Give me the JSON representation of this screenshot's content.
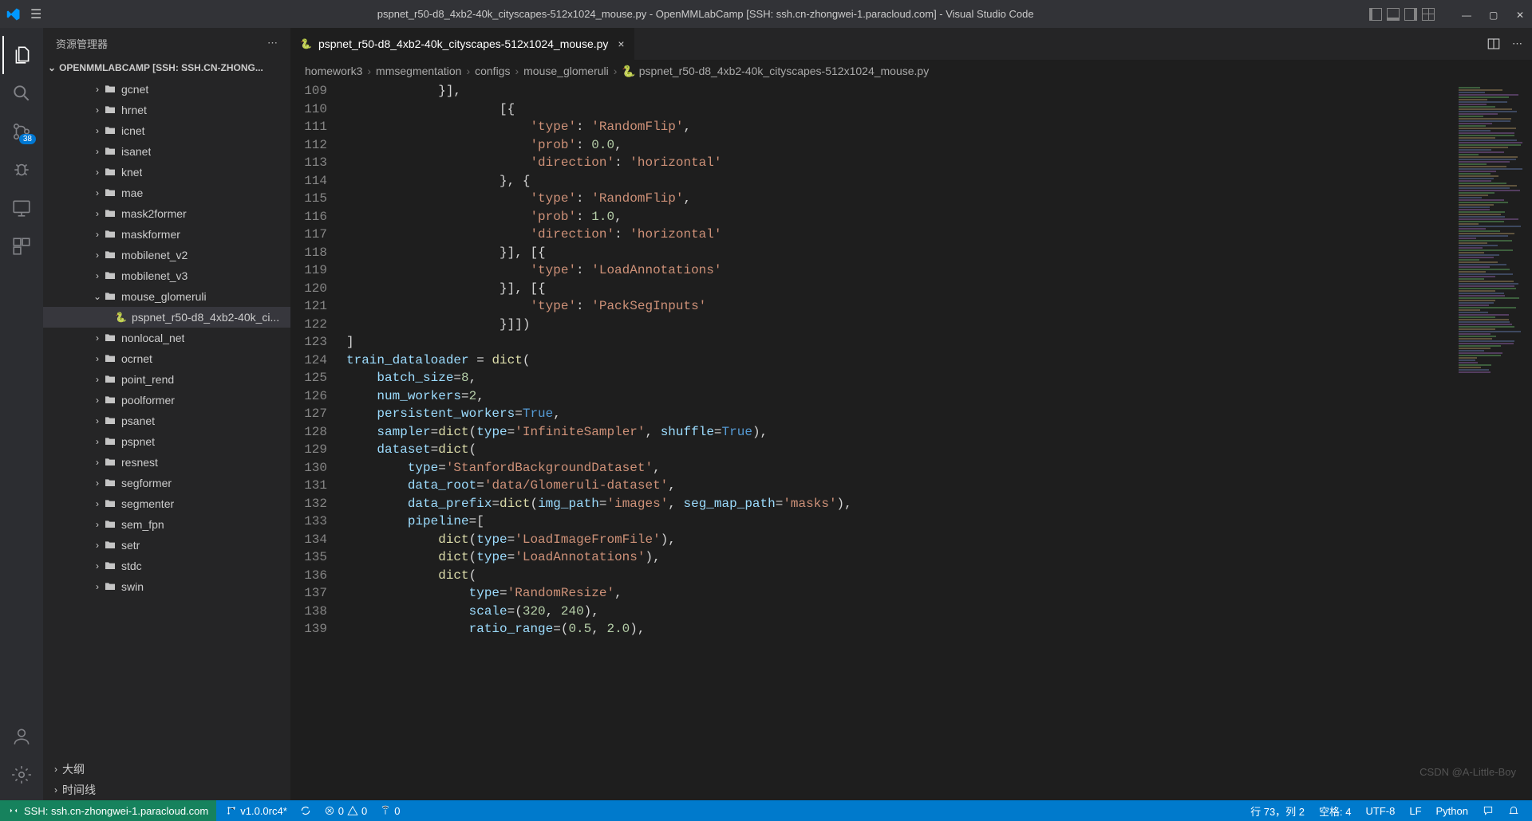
{
  "titlebar": {
    "title": "pspnet_r50-d8_4xb2-40k_cityscapes-512x1024_mouse.py - OpenMMLabCamp [SSH: ssh.cn-zhongwei-1.paracloud.com] - Visual Studio Code"
  },
  "activity": {
    "scm_badge": "38"
  },
  "sidebar": {
    "title": "资源管理器",
    "sectionLabel": "OPENMMLABCAMP [SSH: SSH.CN-ZHONG...",
    "items": [
      {
        "label": "gcnet",
        "depth": 3,
        "expanded": false,
        "type": "folder"
      },
      {
        "label": "hrnet",
        "depth": 3,
        "expanded": false,
        "type": "folder"
      },
      {
        "label": "icnet",
        "depth": 3,
        "expanded": false,
        "type": "folder"
      },
      {
        "label": "isanet",
        "depth": 3,
        "expanded": false,
        "type": "folder"
      },
      {
        "label": "knet",
        "depth": 3,
        "expanded": false,
        "type": "folder"
      },
      {
        "label": "mae",
        "depth": 3,
        "expanded": false,
        "type": "folder"
      },
      {
        "label": "mask2former",
        "depth": 3,
        "expanded": false,
        "type": "folder"
      },
      {
        "label": "maskformer",
        "depth": 3,
        "expanded": false,
        "type": "folder"
      },
      {
        "label": "mobilenet_v2",
        "depth": 3,
        "expanded": false,
        "type": "folder"
      },
      {
        "label": "mobilenet_v3",
        "depth": 3,
        "expanded": false,
        "type": "folder"
      },
      {
        "label": "mouse_glomeruli",
        "depth": 3,
        "expanded": true,
        "type": "folder"
      },
      {
        "label": "pspnet_r50-d8_4xb2-40k_ci...",
        "depth": 4,
        "type": "python",
        "selected": true
      },
      {
        "label": "nonlocal_net",
        "depth": 3,
        "expanded": false,
        "type": "folder"
      },
      {
        "label": "ocrnet",
        "depth": 3,
        "expanded": false,
        "type": "folder"
      },
      {
        "label": "point_rend",
        "depth": 3,
        "expanded": false,
        "type": "folder"
      },
      {
        "label": "poolformer",
        "depth": 3,
        "expanded": false,
        "type": "folder"
      },
      {
        "label": "psanet",
        "depth": 3,
        "expanded": false,
        "type": "folder"
      },
      {
        "label": "pspnet",
        "depth": 3,
        "expanded": false,
        "type": "folder"
      },
      {
        "label": "resnest",
        "depth": 3,
        "expanded": false,
        "type": "folder"
      },
      {
        "label": "segformer",
        "depth": 3,
        "expanded": false,
        "type": "folder"
      },
      {
        "label": "segmenter",
        "depth": 3,
        "expanded": false,
        "type": "folder"
      },
      {
        "label": "sem_fpn",
        "depth": 3,
        "expanded": false,
        "type": "folder"
      },
      {
        "label": "setr",
        "depth": 3,
        "expanded": false,
        "type": "folder"
      },
      {
        "label": "stdc",
        "depth": 3,
        "expanded": false,
        "type": "folder"
      },
      {
        "label": "swin",
        "depth": 3,
        "expanded": false,
        "type": "folder"
      }
    ],
    "outline": "大纲",
    "timeline": "时间线"
  },
  "tab": {
    "label": "pspnet_r50-d8_4xb2-40k_cityscapes-512x1024_mouse.py"
  },
  "breadcrumb": {
    "items": [
      "homework3",
      "mmsegmentation",
      "configs",
      "mouse_glomeruli",
      "pspnet_r50-d8_4xb2-40k_cityscapes-512x1024_mouse.py"
    ]
  },
  "code": {
    "startLine": 109,
    "lines": [
      "            }],",
      "                    [{",
      "                        'type': 'RandomFlip',",
      "                        'prob': 0.0,",
      "                        'direction': 'horizontal'",
      "                    }, {",
      "                        'type': 'RandomFlip',",
      "                        'prob': 1.0,",
      "                        'direction': 'horizontal'",
      "                    }], [{",
      "                        'type': 'LoadAnnotations'",
      "                    }], [{",
      "                        'type': 'PackSegInputs'",
      "                    }]])",
      "]",
      "train_dataloader = dict(",
      "    batch_size=8,",
      "    num_workers=2,",
      "    persistent_workers=True,",
      "    sampler=dict(type='InfiniteSampler', shuffle=True),",
      "    dataset=dict(",
      "        type='StanfordBackgroundDataset',",
      "        data_root='data/Glomeruli-dataset',",
      "        data_prefix=dict(img_path='images', seg_map_path='masks'),",
      "        pipeline=[",
      "            dict(type='LoadImageFromFile'),",
      "            dict(type='LoadAnnotations'),",
      "            dict(",
      "                type='RandomResize',",
      "                scale=(320, 240),",
      "                ratio_range=(0.5, 2.0),"
    ]
  },
  "statusbar": {
    "remote": "SSH: ssh.cn-zhongwei-1.paracloud.com",
    "branch": "v1.0.0rc4*",
    "errors": "0",
    "warnings": "0",
    "ports": "0",
    "position": "行 73，列 2",
    "spaces": "空格: 4",
    "encoding": "UTF-8",
    "eol": "LF",
    "language": "Python"
  },
  "watermark": "CSDN @A-Little-Boy"
}
